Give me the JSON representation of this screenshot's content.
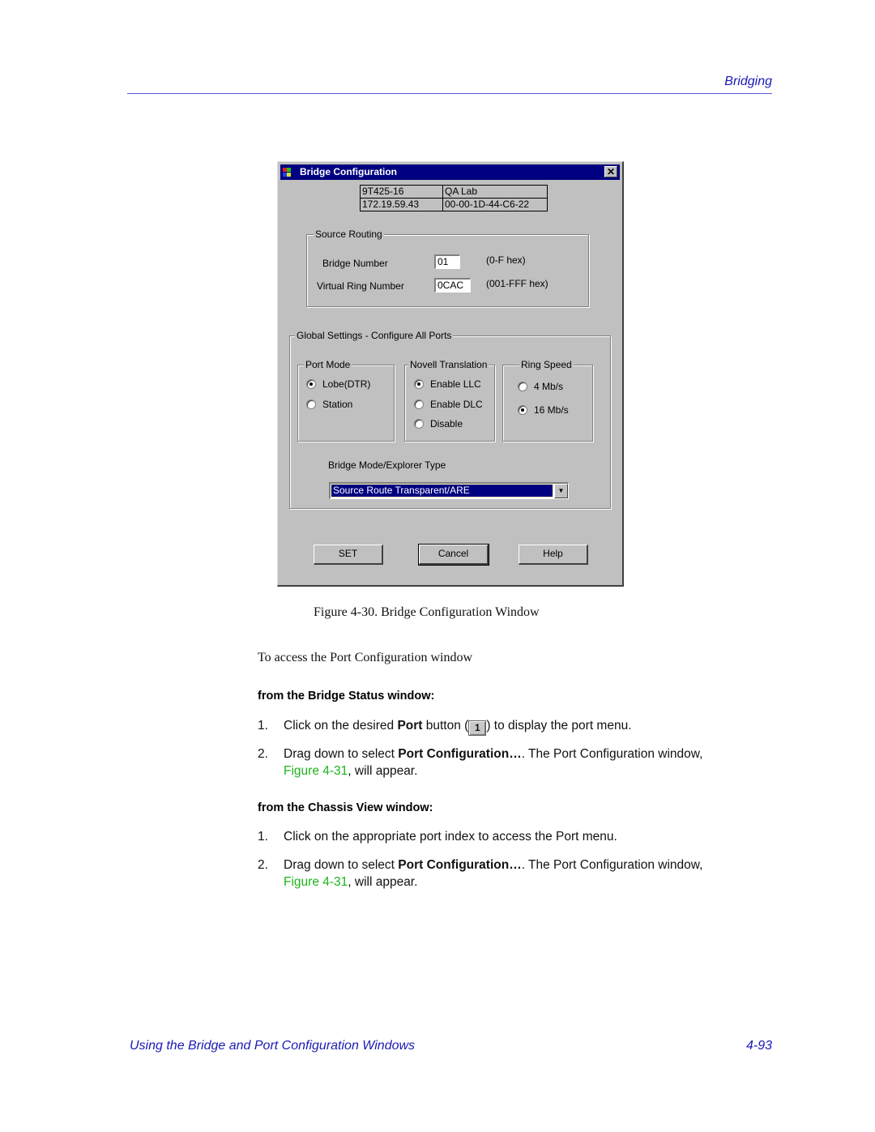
{
  "header": {
    "section_title": "Bridging"
  },
  "window": {
    "title": "Bridge Configuration",
    "close_glyph": "✕",
    "info": {
      "device_name": "9T425-16",
      "location": "QA Lab",
      "ip_address": "172.19.59.43",
      "mac_address": "00-00-1D-44-C6-22"
    },
    "source_routing": {
      "label": "Source Routing",
      "bridge_number_label": "Bridge Number",
      "bridge_number_value": "01",
      "bridge_number_hint": "(0-F  hex)",
      "ring_number_label": "Virtual Ring Number",
      "ring_number_value": "0CAC",
      "ring_number_hint": "(001-FFF hex)"
    },
    "global_settings": {
      "label": "Global Settings - Configure All Ports",
      "port_mode": {
        "label": "Port Mode",
        "options": [
          "Lobe(DTR)",
          "Station"
        ],
        "selected": "Lobe(DTR)"
      },
      "novell_translation": {
        "label": "Novell Translation",
        "options": [
          "Enable  LLC",
          "Enable DLC",
          "Disable"
        ],
        "selected": "Enable  LLC"
      },
      "ring_speed": {
        "label": "Ring Speed",
        "options": [
          "4 Mb/s",
          "16 Mb/s"
        ],
        "selected": "16 Mb/s"
      },
      "bridge_mode_label": "Bridge Mode/Explorer Type",
      "bridge_mode_value": "Source Route Transparent/ARE"
    },
    "buttons": {
      "set": "SET",
      "cancel": "Cancel",
      "help": "Help"
    }
  },
  "caption": "Figure 4-30.  Bridge Configuration Window",
  "intro": "To access the Port Configuration window",
  "sections": [
    {
      "heading": "from the Bridge Status window:",
      "steps": [
        {
          "num": "1.",
          "pre": "Click on the desired ",
          "bold": "Port",
          "mid": " button (",
          "button": "1",
          "post": ") to display the port menu."
        },
        {
          "num": "2.",
          "pre": "Drag down to select ",
          "bold": "Port Configuration…",
          "post": ". The Port Configuration window,",
          "link": "Figure 4-31",
          "tail": ", will appear."
        }
      ]
    },
    {
      "heading": "from the Chassis View window:",
      "steps": [
        {
          "num": "1.",
          "pre": "Click on the appropriate port index to access the Port menu."
        },
        {
          "num": "2.",
          "pre": "Drag down to select ",
          "bold": "Port Configuration…",
          "post": ". The Port Configuration window,",
          "link": "Figure 4-31",
          "tail": ", will appear."
        }
      ]
    }
  ],
  "footer": {
    "chapter_title": "Using the Bridge and Port Configuration Windows",
    "page_number": "4-93"
  },
  "colors": {
    "header_blue": "#1a1ab4",
    "link_green": "#1db31d",
    "titlebar": "#000080",
    "dialog_gray": "#c0c0c0"
  }
}
